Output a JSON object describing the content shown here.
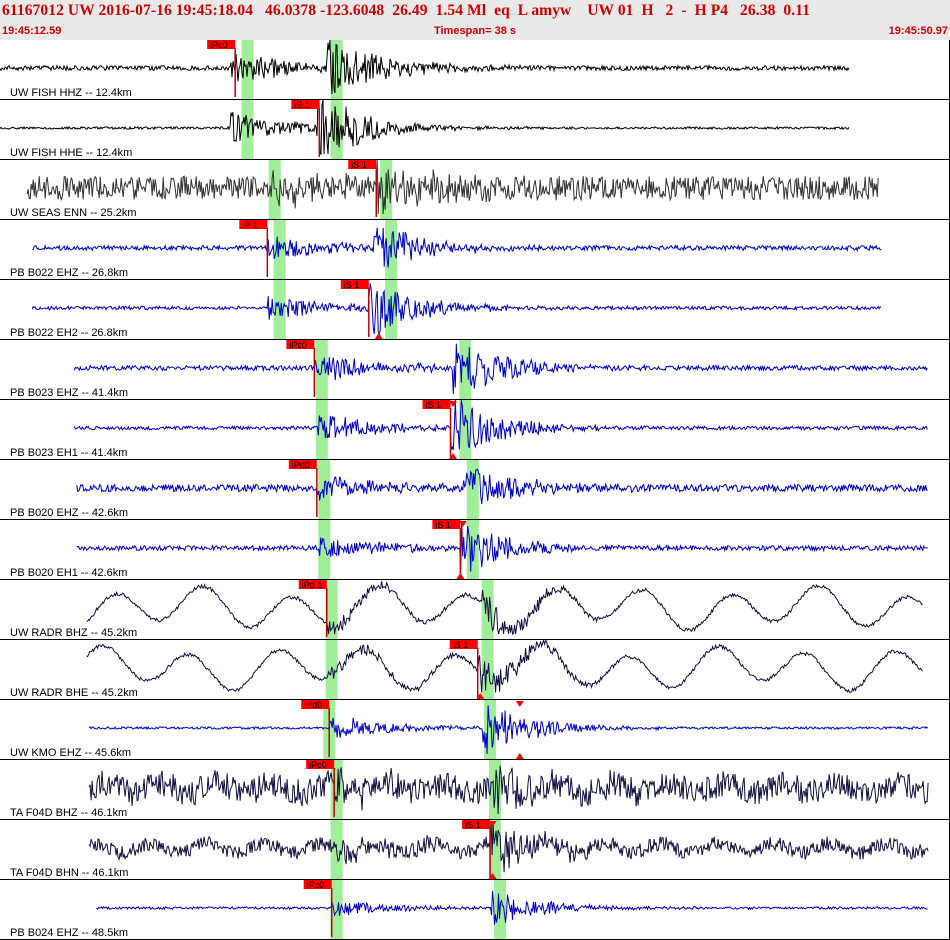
{
  "header": {
    "event_line": "61167012 UW 2016-07-16 19:45:18.04   46.0378 -123.6048  26.49  1.54 Ml  eq  L amyw    UW 01  H   2  -  H P4   26.38  0.11",
    "start_time": "19:45:12.59",
    "timespan": "Timespan=  38 s",
    "end_time": "19:45:50.97"
  },
  "chart_data": {
    "type": "line",
    "title": "",
    "colors": {
      "black": "#000000",
      "gray": "#333333",
      "blue": "#0000cc",
      "navy": "#101040",
      "pick_bg": "#ff0000",
      "pick_line": "#c00000",
      "theo_band": "#a0ee98",
      "divider": "#000000"
    },
    "x_range_s": [
      0,
      38.38
    ],
    "channels": [
      {
        "label": "UW FISH HHZ -- 12.4km",
        "color": "black",
        "wave": "quake",
        "data_start_s": 0,
        "data_end_s": 34.3,
        "p_s": 9.3,
        "s_s": 13.2,
        "amp": 0.6,
        "noise": 0.04,
        "theo_p_s": 10.0,
        "theo_s_s": 13.6,
        "picks": [
          {
            "label": "iPc0",
            "time_s": 9.5
          }
        ],
        "markers": []
      },
      {
        "label": "UW FISH HHE -- 12.4km",
        "color": "black",
        "wave": "quake",
        "data_start_s": 0,
        "data_end_s": 34.3,
        "p_s": 9.3,
        "s_s": 12.8,
        "amp": 0.6,
        "noise": 0.02,
        "theo_p_s": 10.0,
        "theo_s_s": 13.6,
        "picks": [
          {
            "label": "iS 1",
            "time_s": 12.9
          }
        ],
        "markers": []
      },
      {
        "label": "UW SEAS ENN -- 25.2km",
        "color": "gray",
        "wave": "quake",
        "data_start_s": 1.1,
        "data_end_s": 35.5,
        "p_s": 11.0,
        "s_s": 15.2,
        "amp": 0.5,
        "noise": 0.2,
        "theo_p_s": 11.1,
        "theo_s_s": 15.6,
        "picks": [
          {
            "label": "iS 1",
            "time_s": 15.2
          }
        ],
        "markers": []
      },
      {
        "label": "PB B022 EHZ -- 26.8km",
        "color": "blue",
        "wave": "quake",
        "data_start_s": 1.3,
        "data_end_s": 35.6,
        "p_s": 10.8,
        "s_s": 15.0,
        "amp": 0.5,
        "noise": 0.04,
        "theo_p_s": 11.3,
        "theo_s_s": 15.8,
        "picks": [
          {
            "label": "iP 1",
            "time_s": 10.8
          }
        ],
        "markers": []
      },
      {
        "label": "PB B022 EH2 -- 26.8km",
        "color": "blue",
        "wave": "quake",
        "data_start_s": 1.3,
        "data_end_s": 35.6,
        "p_s": 10.8,
        "s_s": 14.9,
        "amp": 0.5,
        "noise": 0.03,
        "theo_p_s": 11.3,
        "theo_s_s": 15.8,
        "picks": [
          {
            "label": "iS 1",
            "time_s": 14.9
          }
        ],
        "markers": [
          {
            "type": "up",
            "time_s": 15.3
          }
        ]
      },
      {
        "label": "PB B023 EHZ -- 41.4km",
        "color": "blue",
        "wave": "quake",
        "data_start_s": 3.0,
        "data_end_s": 37.5,
        "p_s": 12.7,
        "s_s": 18.3,
        "amp": 0.55,
        "noise": 0.04,
        "theo_p_s": 13.0,
        "theo_s_s": 18.8,
        "picks": [
          {
            "label": "iPc0",
            "time_s": 12.7
          }
        ],
        "markers": []
      },
      {
        "label": "PB B023 EH1 -- 41.4km",
        "color": "blue",
        "wave": "quake",
        "data_start_s": 3.0,
        "data_end_s": 37.5,
        "p_s": 12.8,
        "s_s": 18.2,
        "amp": 0.55,
        "noise": 0.03,
        "theo_p_s": 13.0,
        "theo_s_s": 18.8,
        "picks": [
          {
            "label": "iS 1",
            "time_s": 18.2
          }
        ],
        "markers": [
          {
            "type": "down",
            "time_s": 18.3
          },
          {
            "type": "up",
            "time_s": 18.3
          }
        ]
      },
      {
        "label": "PB B020 EHZ -- 42.6km",
        "color": "blue",
        "wave": "quake",
        "data_start_s": 3.1,
        "data_end_s": 37.5,
        "p_s": 12.8,
        "s_s": 18.7,
        "amp": 0.45,
        "noise": 0.06,
        "theo_p_s": 13.1,
        "theo_s_s": 19.1,
        "picks": [
          {
            "label": "iPd0",
            "time_s": 12.8
          }
        ],
        "markers": []
      },
      {
        "label": "PB B020 EH1 -- 42.6km",
        "color": "blue",
        "wave": "quake",
        "data_start_s": 3.1,
        "data_end_s": 37.5,
        "p_s": 12.9,
        "s_s": 18.6,
        "amp": 0.45,
        "noise": 0.04,
        "theo_p_s": 13.1,
        "theo_s_s": 19.1,
        "picks": [
          {
            "label": "iS 1",
            "time_s": 18.6
          }
        ],
        "markers": [
          {
            "type": "down",
            "time_s": 18.7
          },
          {
            "type": "up",
            "time_s": 18.6
          }
        ]
      },
      {
        "label": "UW RADR BHZ -- 45.2km",
        "color": "navy",
        "wave": "swell",
        "data_start_s": 3.5,
        "data_end_s": 37.3,
        "p_s": 13.2,
        "s_s": 19.4,
        "amp": 0.35,
        "noise": 0.03,
        "theo_p_s": 13.4,
        "theo_s_s": 19.7,
        "picks": [
          {
            "label": "iPd 1",
            "time_s": 13.2
          }
        ],
        "markers": []
      },
      {
        "label": "UW RADR BHE -- 45.2km",
        "color": "navy",
        "wave": "swell",
        "data_start_s": 3.5,
        "data_end_s": 37.3,
        "p_s": 13.2,
        "s_s": 19.3,
        "amp": 0.35,
        "noise": 0.03,
        "theo_p_s": 13.4,
        "theo_s_s": 19.7,
        "picks": [
          {
            "label": "iS 1",
            "time_s": 19.3
          }
        ],
        "markers": [
          {
            "type": "up",
            "time_s": 19.4
          }
        ]
      },
      {
        "label": "UW KMO EHZ -- 45.6km",
        "color": "blue",
        "wave": "quake",
        "data_start_s": 3.6,
        "data_end_s": 37.5,
        "p_s": 13.3,
        "s_s": 19.5,
        "amp": 0.5,
        "noise": 0.02,
        "theo_p_s": 13.3,
        "theo_s_s": 19.8,
        "picks": [
          {
            "label": "iPd0",
            "time_s": 13.3
          }
        ],
        "markers": [
          {
            "type": "down",
            "time_s": 21.0
          },
          {
            "type": "up",
            "time_s": 21.0
          }
        ]
      },
      {
        "label": "TA F04D BHZ -- 46.1km",
        "color": "navy",
        "wave": "noisy",
        "data_start_s": 3.6,
        "data_end_s": 37.5,
        "p_s": 13.5,
        "s_s": 19.9,
        "amp": 0.45,
        "noise": 0.22,
        "theo_p_s": 13.6,
        "theo_s_s": 20.0,
        "picks": [
          {
            "label": "iPc0",
            "time_s": 13.5
          }
        ],
        "markers": []
      },
      {
        "label": "TA F04D BHN -- 46.1km",
        "color": "navy",
        "wave": "noisy",
        "data_start_s": 3.6,
        "data_end_s": 37.5,
        "p_s": 13.5,
        "s_s": 19.8,
        "amp": 0.45,
        "noise": 0.12,
        "theo_p_s": 13.6,
        "theo_s_s": 20.0,
        "picks": [
          {
            "label": "iS 1",
            "time_s": 19.8
          }
        ],
        "markers": [
          {
            "type": "down",
            "time_s": 19.9
          },
          {
            "type": "up",
            "time_s": 19.9
          }
        ]
      },
      {
        "label": "PB B024 EHZ -- 48.5km",
        "color": "blue",
        "wave": "quake",
        "data_start_s": 3.9,
        "data_end_s": 37.5,
        "p_s": 13.4,
        "s_s": 19.8,
        "amp": 0.35,
        "noise": 0.02,
        "theo_p_s": 13.6,
        "theo_s_s": 20.2,
        "picks": [
          {
            "label": "iPc0",
            "time_s": 13.4
          }
        ],
        "markers": []
      }
    ]
  }
}
